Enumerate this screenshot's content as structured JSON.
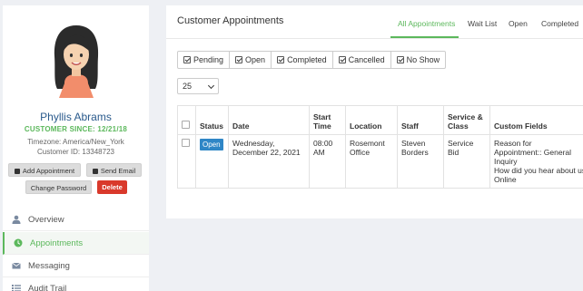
{
  "profile": {
    "name": "Phyllis Abrams",
    "customer_since": "CUSTOMER SINCE: 12/21/18",
    "timezone": "Timezone: America/New_York",
    "customer_id": "Customer ID: 13348723",
    "buttons": {
      "add_appointment": "Add Appointment",
      "send_email": "Send Email",
      "change_password": "Change Password",
      "delete": "Delete"
    }
  },
  "nav": {
    "items": [
      {
        "label": "Overview",
        "icon": "user-icon"
      },
      {
        "label": "Appointments",
        "icon": "clock-icon"
      },
      {
        "label": "Messaging",
        "icon": "envelope-icon"
      },
      {
        "label": "Audit Trail",
        "icon": "list-icon"
      }
    ],
    "active": "Appointments"
  },
  "main": {
    "title": "Customer Appointments",
    "tabs": [
      "All Appointments",
      "Wait List",
      "Open",
      "Completed"
    ],
    "active_tab": "All Appointments",
    "filters": [
      "Pending",
      "Open",
      "Completed",
      "Cancelled",
      "No Show"
    ],
    "page_size": "25"
  },
  "table": {
    "headers": {
      "status": "Status",
      "date": "Date",
      "start_time": "Start Time",
      "location": "Location",
      "staff": "Staff",
      "service_class": "Service & Class",
      "custom_fields": "Custom Fields"
    },
    "rows": [
      {
        "status": "Open",
        "date": "Wednesday, December 22, 2021",
        "start_time": "08:00 AM",
        "location": "Rosemont Office",
        "staff": "Steven Borders",
        "service_class": "Service Bid",
        "custom_fields": [
          "Reason for Appointment:: General Inquiry",
          "How did you hear about us",
          "Online"
        ]
      }
    ]
  },
  "colors": {
    "accent_green": "#5cb85c",
    "name_blue": "#2a5a8c",
    "status_blue": "#2f86c6",
    "delete_red": "#d9392b"
  }
}
